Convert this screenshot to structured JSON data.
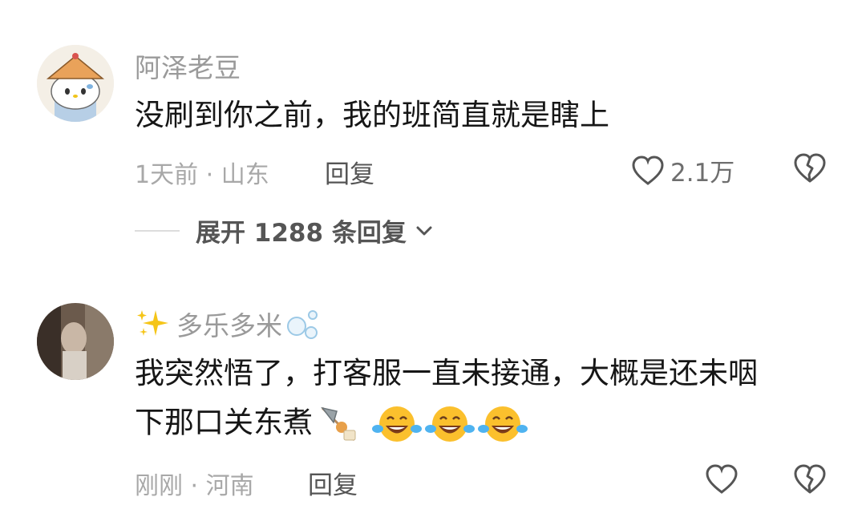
{
  "comments": [
    {
      "username": "阿泽老豆",
      "text_lines": [
        "没刷到你之前，我的班简直就是瞎上"
      ],
      "time": "1天前",
      "location": "山东",
      "reply_label": "回复",
      "like_count": "2.1万",
      "expand_replies_label": "展开 1288 条回复"
    },
    {
      "username": "多乐多米",
      "text_lines": [
        "我突然悟了，打客服一直未接通，大概是还未咽",
        "下那口关东煮"
      ],
      "time": "刚刚",
      "location": "河南",
      "reply_label": "回复",
      "like_count": ""
    }
  ],
  "separator": "·",
  "icons": {
    "heart": "heart-outline-icon",
    "broken_heart": "broken-heart-icon",
    "chevron": "chevron-down-icon",
    "sparkle": "sparkles-icon",
    "bubbles": "bubbles-icon",
    "oden": "oden-skewer-icon",
    "laugh": "tears-of-joy-emoji"
  },
  "colors": {
    "username": "#9a9a9a",
    "text": "#161616",
    "meta": "#a8a8a8",
    "action": "#555555"
  }
}
